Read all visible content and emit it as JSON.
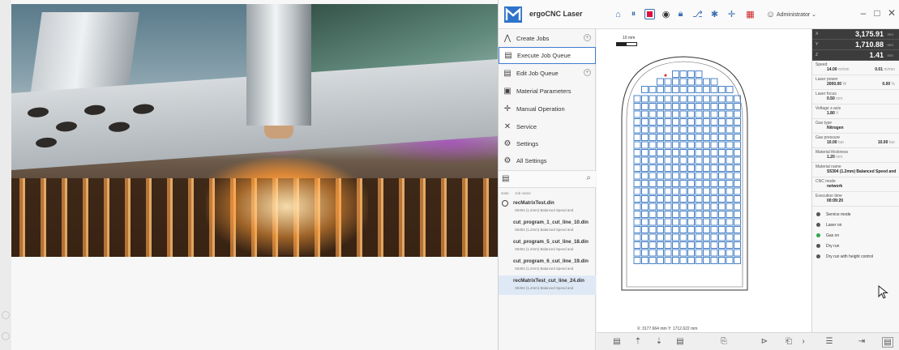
{
  "app": {
    "title": "ergoCNC Laser",
    "user": "Administrator",
    "window_controls": {
      "minimize": "–",
      "maximize": "□",
      "close": "✕"
    }
  },
  "sidebar": {
    "items": [
      {
        "label": "Create Jobs",
        "icon": "create-jobs-icon",
        "expandable": true
      },
      {
        "label": "Execute Job Queue",
        "icon": "queue-icon",
        "active": true
      },
      {
        "label": "Edit Job Queue",
        "icon": "edit-queue-icon",
        "expandable": true
      },
      {
        "label": "Material Parameters",
        "icon": "material-icon"
      },
      {
        "label": "Manual Operation",
        "icon": "move-icon"
      },
      {
        "label": "Service",
        "icon": "wrench-icon"
      },
      {
        "label": "Settings",
        "icon": "gear-icon"
      },
      {
        "label": "All Settings",
        "icon": "all-settings-icon"
      }
    ]
  },
  "queue": {
    "columns": {
      "state": "state",
      "name": "Job name"
    },
    "jobs": [
      {
        "name": "recMatrixTest.din",
        "sub": "S5304 (1.2mm) Balanced Speed and",
        "running": true
      },
      {
        "name": "cut_program_1_cut_line_10.din",
        "sub": "S5304 (1.2mm) Balanced Speed and"
      },
      {
        "name": "cut_program_5_cut_line_18.din",
        "sub": "S5304 (1.2mm) Balanced Speed and"
      },
      {
        "name": "cut_program_6_cut_line_19.din",
        "sub": "S5304 (1.2mm) Balanced Speed and"
      },
      {
        "name": "recMatrixTest_cut_line_24.din",
        "sub": "S5304 (1.2mm) Balanced Speed and",
        "selected": true
      }
    ]
  },
  "canvas": {
    "scale_label": "10 mm",
    "coordinates": "X: 3177.664 mm  Y: 1712.622 mm",
    "grid": {
      "cols": 14,
      "rows": 22,
      "arch_rows": 3
    }
  },
  "dro": [
    {
      "axis": "X",
      "value": "3,175.91",
      "unit": "mm"
    },
    {
      "axis": "Y",
      "value": "1,710.88",
      "unit": "mm"
    },
    {
      "axis": "Z",
      "value": "1.41",
      "unit": "mm"
    }
  ],
  "params": {
    "speed": {
      "label": "Speed",
      "value": "14.00",
      "unit": "m/min",
      "value2": "0.01",
      "unit2": "m/min"
    },
    "laser_power": {
      "label": "Laser power",
      "value": "2000.00",
      "unit": "W",
      "value2": "0.00",
      "unit2": "%"
    },
    "laser_focus": {
      "label": "Laser focus",
      "value": "0.50",
      "unit": "mm"
    },
    "voltage": {
      "label": "Voltage z-axis",
      "value": "1.80",
      "unit": "V"
    },
    "gas_type": {
      "label": "Gas type",
      "value": "Nitrogen"
    },
    "gas_pressure": {
      "label": "Gas pressure",
      "value": "10.00",
      "unit": "bar",
      "value2": "10.00",
      "unit2": "bar"
    },
    "material_thickness": {
      "label": "Material thickness",
      "value": "1.20",
      "unit": "mm"
    },
    "material_name": {
      "label": "Material name",
      "value": "S5304 (1.2mm) Balanced Speed and"
    },
    "cnc_mode": {
      "label": "CNC mode",
      "value": "network"
    },
    "execution_time": {
      "label": "Execution time",
      "value": "00:09:20"
    }
  },
  "status": [
    {
      "label": "Service mode",
      "on": false
    },
    {
      "label": "Laser on",
      "on": false
    },
    {
      "label": "Gas on",
      "on": true
    },
    {
      "label": "Dry run",
      "on": false
    },
    {
      "label": "Dry run with height control",
      "on": false
    }
  ],
  "colors": {
    "accent": "#3f7bd1",
    "part_stroke": "#3a78c2",
    "dro_bg": "#3c3c3c",
    "status_on": "#2fa84f"
  }
}
